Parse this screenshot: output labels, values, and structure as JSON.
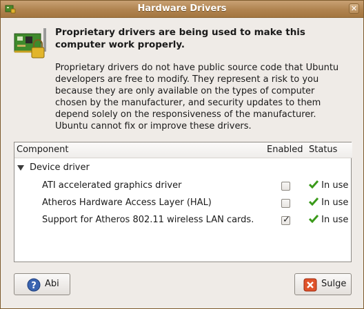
{
  "window": {
    "title": "Hardware Drivers"
  },
  "header": {
    "headline": "Proprietary drivers are being used to make this computer work properly.",
    "description": "Proprietary drivers do not have public source code that Ubuntu developers are free to modify. They represent a risk to you because they are only available on the types of computer chosen by the manufacturer, and security updates to them depend solely on the responsiveness of the manufacturer. Ubuntu cannot fix or improve these drivers."
  },
  "table": {
    "columns": {
      "component": "Component",
      "enabled": "Enabled",
      "status": "Status"
    },
    "group": {
      "label": "Device driver",
      "expanded": true
    },
    "rows": [
      {
        "component": "ATI accelerated graphics driver",
        "enabled": false,
        "status": "In use"
      },
      {
        "component": "Atheros Hardware Access Layer (HAL)",
        "enabled": false,
        "status": "In use"
      },
      {
        "component": "Support for Atheros 802.11 wireless LAN cards.",
        "enabled": true,
        "status": "In use"
      }
    ]
  },
  "buttons": {
    "help": {
      "label": "Abi",
      "icon": "help-icon"
    },
    "close": {
      "label": "Sulge",
      "icon": "close-icon"
    }
  },
  "colors": {
    "titlebar": "#b0834f",
    "status_ok": "#3a9a1a"
  }
}
